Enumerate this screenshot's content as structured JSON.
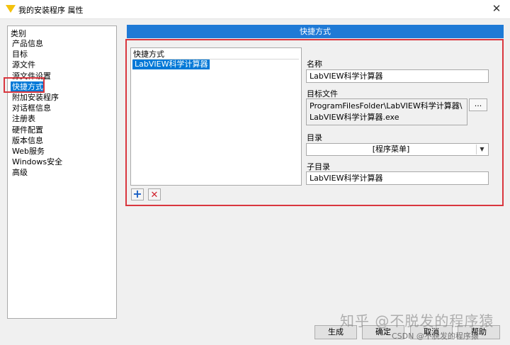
{
  "window": {
    "title": "我的安装程序 属性",
    "close_glyph": "✕"
  },
  "sidebar": {
    "header": "类别",
    "items": [
      {
        "label": "产品信息"
      },
      {
        "label": "目标"
      },
      {
        "label": "源文件"
      },
      {
        "label": "源文件设置"
      },
      {
        "label": "快捷方式",
        "selected": true
      },
      {
        "label": "附加安装程序"
      },
      {
        "label": "对话框信息"
      },
      {
        "label": "注册表"
      },
      {
        "label": "硬件配置"
      },
      {
        "label": "版本信息"
      },
      {
        "label": "Web服务"
      },
      {
        "label": "Windows安全"
      },
      {
        "label": "高级"
      }
    ]
  },
  "main": {
    "section_title": "快捷方式",
    "shortcut_list": {
      "header": "快捷方式",
      "rows": [
        "LabVIEW科学计算器"
      ]
    },
    "tools": {
      "add_glyph": "+",
      "delete_glyph": "✕"
    },
    "name": {
      "label": "名称",
      "value": "LabVIEW科学计算器"
    },
    "target_file": {
      "label": "目标文件",
      "line1": "ProgramFilesFolder\\LabVIEW科学计算器\\",
      "line2": "LabVIEW科学计算器.exe",
      "browse_label": "..."
    },
    "directory": {
      "label": "目录",
      "value": "[程序菜单]",
      "arrow_glyph": "⌄"
    },
    "subdirectory": {
      "label": "子目录",
      "value": "LabVIEW科学计算器"
    }
  },
  "footer": {
    "build_label": "生成",
    "ok_label": "确定",
    "cancel_label": "取消",
    "help_label": "帮助"
  },
  "watermark": {
    "text": "知乎 @不脱发的程序猿",
    "csdn": "CSDN @不脱发的程序猿"
  },
  "colors": {
    "accent": "#1f7ad6",
    "selection": "#0078d7",
    "highlight_border": "#d9363e",
    "add_icon": "#1a5fc4",
    "delete_icon": "#d0212c"
  }
}
